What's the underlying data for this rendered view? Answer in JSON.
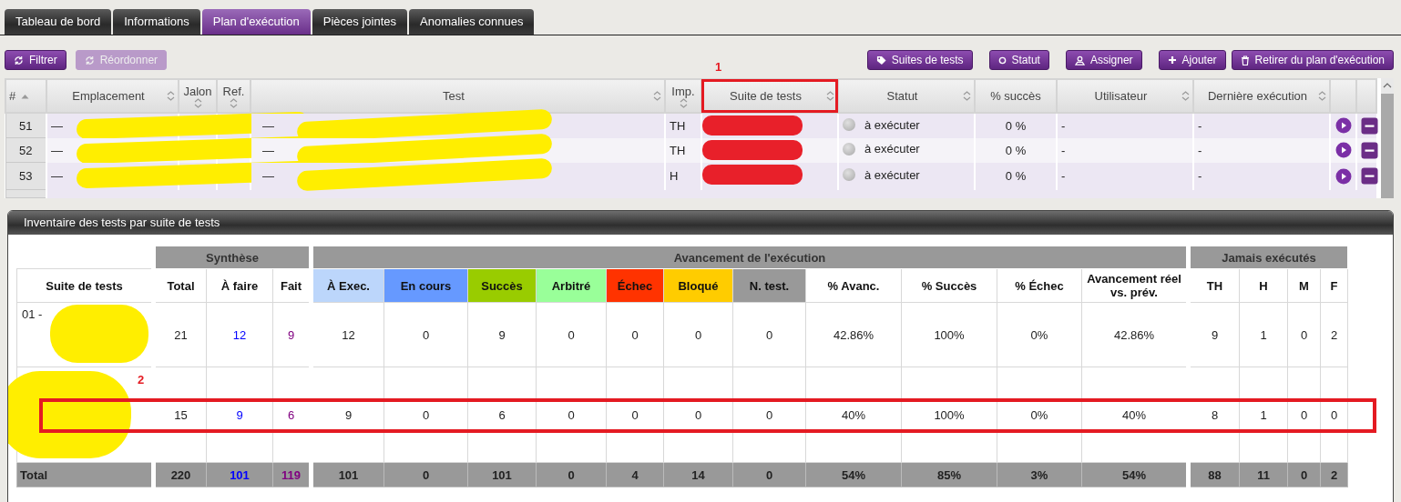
{
  "tabs": [
    {
      "label": "Tableau de bord",
      "selected": false
    },
    {
      "label": "Informations",
      "selected": false
    },
    {
      "label": "Plan d'exécution",
      "selected": true
    },
    {
      "label": "Pièces jointes",
      "selected": false
    },
    {
      "label": "Anomalies connues",
      "selected": false
    }
  ],
  "toolbar_left": [
    {
      "label": "Filtrer",
      "disabled": false
    },
    {
      "label": "Réordonner",
      "disabled": true
    }
  ],
  "toolbar_right": [
    {
      "label": "Suites de tests"
    },
    {
      "label": "Statut"
    },
    {
      "label": "Assigner"
    },
    {
      "label": "Ajouter"
    },
    {
      "label": "Retirer du plan d'exécution"
    }
  ],
  "grid": {
    "columns": [
      {
        "label": "#"
      },
      {
        "label": "Emplacement"
      },
      {
        "label": "Jalon"
      },
      {
        "label": "Ref."
      },
      {
        "label": "Test"
      },
      {
        "label": "Imp."
      },
      {
        "label": "Suite de tests"
      },
      {
        "label": "Statut"
      },
      {
        "label": "% succès"
      },
      {
        "label": "Utilisateur"
      },
      {
        "label": "Dernière exécution"
      }
    ],
    "rows": [
      {
        "number": "51",
        "location": "—",
        "test": "—",
        "importance": "TH",
        "status": "à exécuter",
        "success": "0 %",
        "user": "-",
        "last_execution": "-"
      },
      {
        "number": "52",
        "location": "—",
        "test": "—",
        "importance": "TH",
        "status": "à exécuter",
        "success": "0 %",
        "user": "-",
        "last_execution": "-"
      },
      {
        "number": "53",
        "location": "—",
        "test": "—",
        "importance": "H",
        "status": "à exécuter",
        "success": "0 %",
        "user": "-",
        "last_execution": "-"
      }
    ]
  },
  "annotations": [
    {
      "label": "1",
      "kind": "header"
    },
    {
      "label": "2",
      "kind": "row"
    }
  ],
  "inventory": {
    "title": "Inventaire des tests par suite de tests",
    "groups": [
      {
        "columns": [
          {
            "label": "Suite de tests",
            "kind": "name"
          }
        ]
      },
      {
        "label": "Synthèse",
        "columns": [
          {
            "label": "Total",
            "kind": "count"
          },
          {
            "label": "À faire",
            "kind": "todo"
          },
          {
            "label": "Fait",
            "kind": "done"
          }
        ]
      },
      {
        "label": "Avancement de l'exécution",
        "columns": [
          {
            "label": "À Exec.",
            "kind": "status",
            "color": "#bcd6fb"
          },
          {
            "label": "En cours",
            "kind": "status",
            "color": "#6699ff"
          },
          {
            "label": "Succès",
            "kind": "status",
            "color": "#99cc00"
          },
          {
            "label": "Arbitré",
            "kind": "status",
            "color": "#99ff99"
          },
          {
            "label": "Échec",
            "kind": "status",
            "color": "#ff3300"
          },
          {
            "label": "Bloqué",
            "kind": "status",
            "color": "#ffcc00"
          },
          {
            "label": "N. test.",
            "kind": "status",
            "color": "#999999"
          },
          {
            "label": "% Avanc.",
            "kind": "count"
          },
          {
            "label": "% Succès",
            "kind": "count"
          },
          {
            "label": "% Échec",
            "kind": "count"
          },
          {
            "label": "Avancement réel vs. prév.",
            "kind": "count"
          }
        ]
      },
      {
        "label": "Jamais exécutés",
        "columns": [
          {
            "label": "TH",
            "kind": "count"
          },
          {
            "label": "H",
            "kind": "count"
          },
          {
            "label": "M",
            "kind": "count"
          },
          {
            "label": "F",
            "kind": "count"
          }
        ]
      }
    ],
    "rows": [
      {
        "suite": "01 -",
        "values": [
          "21",
          "12",
          "9",
          "12",
          "0",
          "9",
          "0",
          "0",
          "0",
          "0",
          "42.86%",
          "100%",
          "0%",
          "42.86%",
          "9",
          "1",
          "0",
          "2"
        ]
      },
      {
        "values": [
          "15",
          "9",
          "6",
          "9",
          "0",
          "6",
          "0",
          "0",
          "0",
          "0",
          "40%",
          "100%",
          "0%",
          "40%",
          "8",
          "1",
          "0",
          "0"
        ]
      }
    ],
    "total": {
      "label": "Total",
      "values": [
        "220",
        "101",
        "119",
        "101",
        "0",
        "101",
        "0",
        "4",
        "14",
        "0",
        "54%",
        "85%",
        "3%",
        "54%",
        "88",
        "11",
        "0",
        "2"
      ]
    }
  }
}
